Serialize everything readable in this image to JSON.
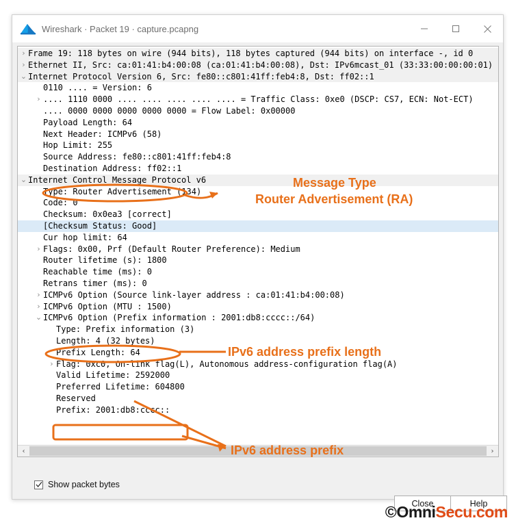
{
  "window": {
    "title": "Wireshark · Packet 19 · capture.pcapng",
    "app_icon": "wireshark-fin-icon",
    "controls": {
      "minimize": "minimize-icon",
      "maximize": "maximize-icon",
      "close": "close-icon"
    }
  },
  "tree": {
    "rows": [
      {
        "indent": 0,
        "twisty": "collapsed",
        "toplevel": true,
        "selected": false,
        "text": "Frame 19: 118 bytes on wire (944 bits), 118 bytes captured (944 bits) on interface -, id 0"
      },
      {
        "indent": 0,
        "twisty": "collapsed",
        "toplevel": true,
        "selected": false,
        "text": "Ethernet II, Src: ca:01:41:b4:00:08 (ca:01:41:b4:00:08), Dst: IPv6mcast_01 (33:33:00:00:00:01)"
      },
      {
        "indent": 0,
        "twisty": "expanded",
        "toplevel": true,
        "selected": false,
        "text": "Internet Protocol Version 6, Src: fe80::c801:41ff:feb4:8, Dst: ff02::1"
      },
      {
        "indent": 1,
        "twisty": "none",
        "toplevel": false,
        "selected": false,
        "text": "0110 .... = Version: 6"
      },
      {
        "indent": 1,
        "twisty": "collapsed",
        "toplevel": false,
        "selected": false,
        "text": ".... 1110 0000 .... .... .... .... .... = Traffic Class: 0xe0 (DSCP: CS7, ECN: Not-ECT)"
      },
      {
        "indent": 1,
        "twisty": "none",
        "toplevel": false,
        "selected": false,
        "text": ".... 0000 0000 0000 0000 0000 = Flow Label: 0x00000"
      },
      {
        "indent": 1,
        "twisty": "none",
        "toplevel": false,
        "selected": false,
        "text": "Payload Length: 64"
      },
      {
        "indent": 1,
        "twisty": "none",
        "toplevel": false,
        "selected": false,
        "text": "Next Header: ICMPv6 (58)"
      },
      {
        "indent": 1,
        "twisty": "none",
        "toplevel": false,
        "selected": false,
        "text": "Hop Limit: 255"
      },
      {
        "indent": 1,
        "twisty": "none",
        "toplevel": false,
        "selected": false,
        "text": "Source Address: fe80::c801:41ff:feb4:8"
      },
      {
        "indent": 1,
        "twisty": "none",
        "toplevel": false,
        "selected": false,
        "text": "Destination Address: ff02::1"
      },
      {
        "indent": 0,
        "twisty": "expanded",
        "toplevel": true,
        "selected": false,
        "text": "Internet Control Message Protocol v6"
      },
      {
        "indent": 1,
        "twisty": "none",
        "toplevel": false,
        "selected": false,
        "text": "Type: Router Advertisement (134)"
      },
      {
        "indent": 1,
        "twisty": "none",
        "toplevel": false,
        "selected": false,
        "text": "Code: 0"
      },
      {
        "indent": 1,
        "twisty": "none",
        "toplevel": false,
        "selected": false,
        "text": "Checksum: 0x0ea3 [correct]"
      },
      {
        "indent": 1,
        "twisty": "none",
        "toplevel": false,
        "selected": true,
        "text": "[Checksum Status: Good]"
      },
      {
        "indent": 1,
        "twisty": "none",
        "toplevel": false,
        "selected": false,
        "text": "Cur hop limit: 64"
      },
      {
        "indent": 1,
        "twisty": "collapsed",
        "toplevel": false,
        "selected": false,
        "text": "Flags: 0x00, Prf (Default Router Preference): Medium"
      },
      {
        "indent": 1,
        "twisty": "none",
        "toplevel": false,
        "selected": false,
        "text": "Router lifetime (s): 1800"
      },
      {
        "indent": 1,
        "twisty": "none",
        "toplevel": false,
        "selected": false,
        "text": "Reachable time (ms): 0"
      },
      {
        "indent": 1,
        "twisty": "none",
        "toplevel": false,
        "selected": false,
        "text": "Retrans timer (ms): 0"
      },
      {
        "indent": 1,
        "twisty": "collapsed",
        "toplevel": false,
        "selected": false,
        "text": "ICMPv6 Option (Source link-layer address : ca:01:41:b4:00:08)"
      },
      {
        "indent": 1,
        "twisty": "collapsed",
        "toplevel": false,
        "selected": false,
        "text": "ICMPv6 Option (MTU : 1500)"
      },
      {
        "indent": 1,
        "twisty": "expanded",
        "toplevel": false,
        "selected": false,
        "text": "ICMPv6 Option (Prefix information : 2001:db8:cccc::/64)"
      },
      {
        "indent": 2,
        "twisty": "none",
        "toplevel": false,
        "selected": false,
        "text": "Type: Prefix information (3)"
      },
      {
        "indent": 2,
        "twisty": "none",
        "toplevel": false,
        "selected": false,
        "text": "Length: 4 (32 bytes)"
      },
      {
        "indent": 2,
        "twisty": "none",
        "toplevel": false,
        "selected": false,
        "text": "Prefix Length: 64"
      },
      {
        "indent": 2,
        "twisty": "collapsed",
        "toplevel": false,
        "selected": false,
        "text": "Flag: 0xc0, On-link flag(L), Autonomous address-configuration flag(A)"
      },
      {
        "indent": 2,
        "twisty": "none",
        "toplevel": false,
        "selected": false,
        "text": "Valid Lifetime: 2592000"
      },
      {
        "indent": 2,
        "twisty": "none",
        "toplevel": false,
        "selected": false,
        "text": "Preferred Lifetime: 604800"
      },
      {
        "indent": 2,
        "twisty": "none",
        "toplevel": false,
        "selected": false,
        "text": "Reserved"
      },
      {
        "indent": 2,
        "twisty": "none",
        "toplevel": false,
        "selected": false,
        "text": "Prefix: 2001:db8:cccc::"
      }
    ],
    "scrollbar": {
      "left_arrow": "chevron-left-icon",
      "right_arrow": "chevron-right-icon"
    }
  },
  "footer": {
    "show_packet_bytes_label": "Show packet bytes",
    "show_packet_bytes_checked": true,
    "close_button": "Close",
    "help_button": "Help"
  },
  "annotations": {
    "color": "#e8701a",
    "message_type": "Message Type",
    "router_advertisement": "Router Advertisement (RA)",
    "prefix_length": "IPv6 address prefix length",
    "prefix": "IPv6 address prefix"
  },
  "branding": {
    "watermark": "OmniSecu.com",
    "logo_dark": "©Omni",
    "logo_orange": "Secu.com"
  }
}
